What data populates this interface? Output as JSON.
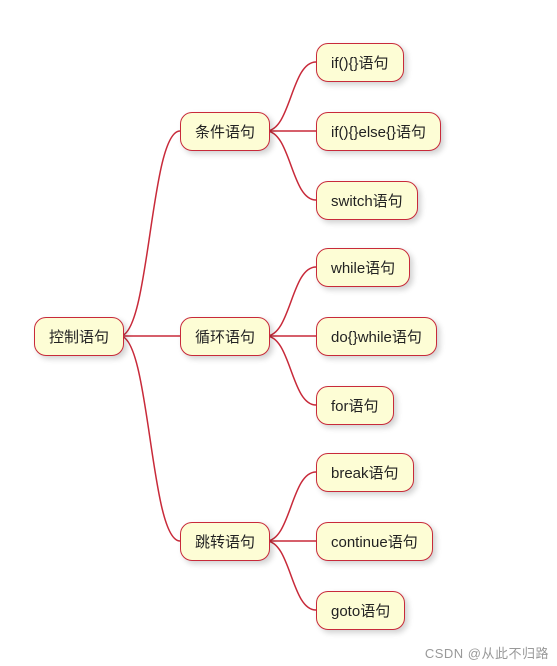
{
  "diagram": {
    "root": {
      "label": "控制语句"
    },
    "branches": [
      {
        "label": "条件语句",
        "children": [
          {
            "label": "if(){}语句"
          },
          {
            "label": "if(){}else{}语句"
          },
          {
            "label": "switch语句"
          }
        ]
      },
      {
        "label": "循环语句",
        "children": [
          {
            "label": "while语句"
          },
          {
            "label": "do{}while语句"
          },
          {
            "label": "for语句"
          }
        ]
      },
      {
        "label": "跳转语句",
        "children": [
          {
            "label": "break语句"
          },
          {
            "label": "continue语句"
          },
          {
            "label": "goto语句"
          }
        ]
      }
    ]
  },
  "watermark": "CSDN @从此不归路",
  "colors": {
    "node_fill": "#fdfdd5",
    "node_border": "#c82a3a",
    "connector": "#c82a3a"
  }
}
